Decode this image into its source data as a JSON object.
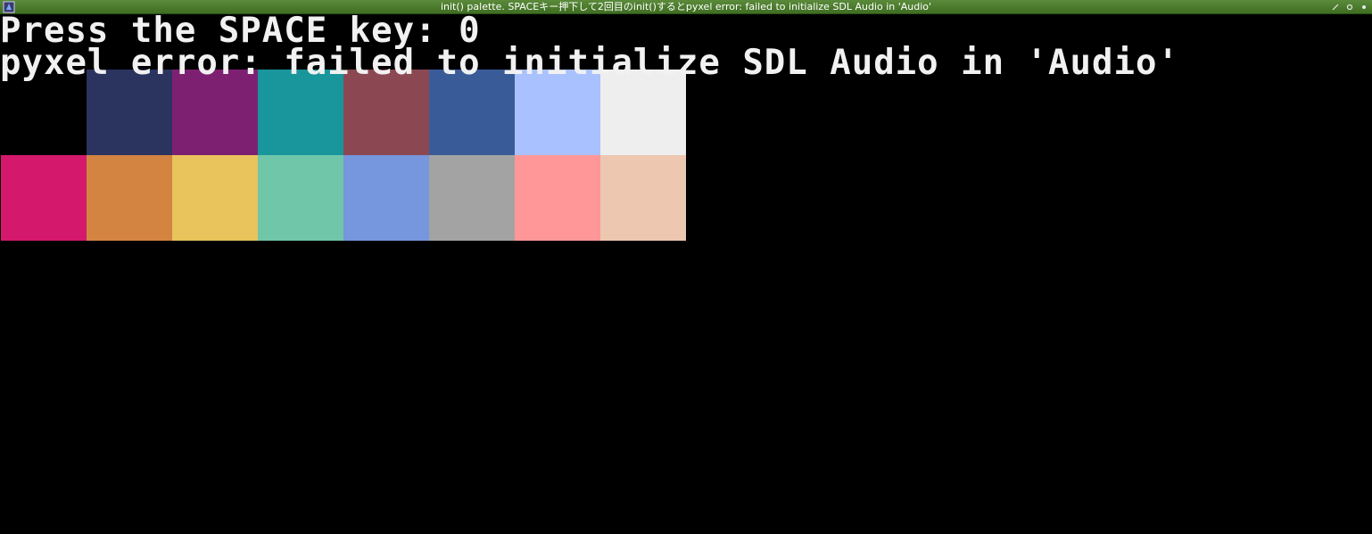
{
  "window": {
    "title": "init() palette. SPACEキー押下して2回目のinit()するとpyxel error: failed to initialize SDL Audio in 'Audio'",
    "icon": "pyxel-app-icon",
    "controls": [
      "maximize-icon",
      "restore-icon",
      "close-icon"
    ]
  },
  "screen": {
    "line1": "Press the SPACE key: 0",
    "line2": "pyxel error: failed to initialize SDL Audio in 'Audio'"
  },
  "palette": {
    "colors": [
      "#000000",
      "#2B335F",
      "#7E2072",
      "#19959C",
      "#8B4852",
      "#395C98",
      "#A9C1FF",
      "#EEEEEE",
      "#D4186C",
      "#D38441",
      "#E9C35B",
      "#70C6A9",
      "#7696DE",
      "#A3A3A3",
      "#FF9798",
      "#EDC7B0"
    ]
  }
}
